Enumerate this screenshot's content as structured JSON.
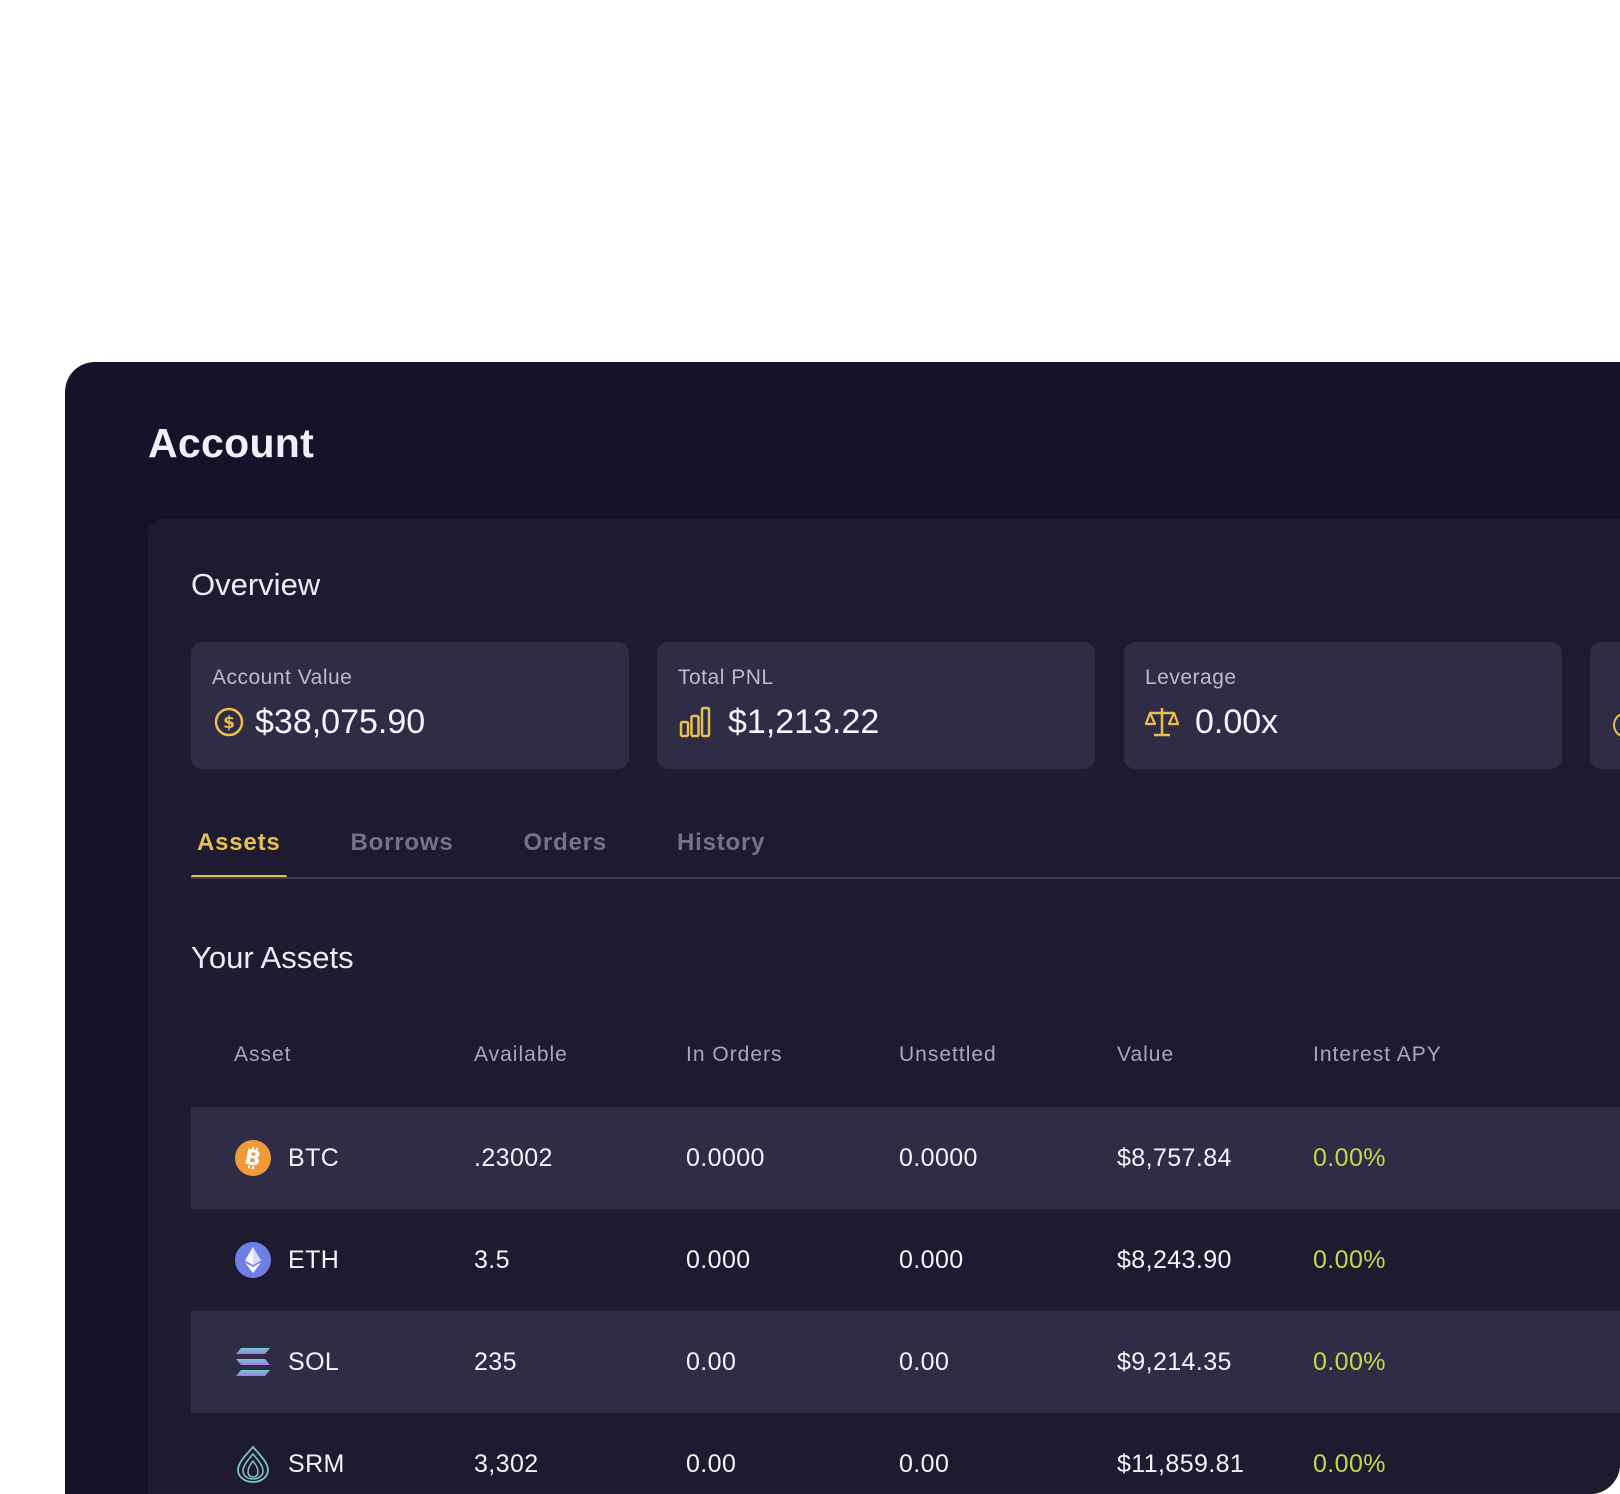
{
  "page": {
    "title": "Account"
  },
  "overview": {
    "title": "Overview",
    "cards": [
      {
        "label": "Account Value",
        "value": "$38,075.90",
        "icon": "dollar-coin-icon"
      },
      {
        "label": "Total PNL",
        "value": "$1,213.22",
        "icon": "bar-chart-icon"
      },
      {
        "label": "Leverage",
        "value": "0.00x",
        "icon": "scale-icon"
      }
    ]
  },
  "tabs": [
    {
      "label": "Assets",
      "active": true
    },
    {
      "label": "Borrows",
      "active": false
    },
    {
      "label": "Orders",
      "active": false
    },
    {
      "label": "History",
      "active": false
    }
  ],
  "assets": {
    "title": "Your Assets",
    "columns": [
      "Asset",
      "Available",
      "In Orders",
      "Unsettled",
      "Value",
      "Interest APY"
    ],
    "rows": [
      {
        "asset": "BTC",
        "icon": "bitcoin-icon",
        "available": ".23002",
        "in_orders": "0.0000",
        "unsettled": "0.0000",
        "value": "$8,757.84",
        "apy": "0.00%"
      },
      {
        "asset": "ETH",
        "icon": "ethereum-icon",
        "available": "3.5",
        "in_orders": "0.000",
        "unsettled": "0.000",
        "value": "$8,243.90",
        "apy": "0.00%"
      },
      {
        "asset": "SOL",
        "icon": "solana-icon",
        "available": "235",
        "in_orders": "0.00",
        "unsettled": "0.00",
        "value": "$9,214.35",
        "apy": "0.00%"
      },
      {
        "asset": "SRM",
        "icon": "serum-icon",
        "available": "3,302",
        "in_orders": "0.00",
        "unsettled": "0.00",
        "value": "$11,859.81",
        "apy": "0.00%"
      }
    ]
  },
  "colors": {
    "background": "#15132a",
    "panel": "#1e1b31",
    "card": "#2f2c45",
    "accent": "#e7c04e",
    "apy_positive": "#c4d94a",
    "btc": "#f09a38",
    "eth": "#6f7fe6",
    "sol_top": "#5fd6c0",
    "sol_bottom": "#b76ef0",
    "srm": "#7cc5c4"
  }
}
